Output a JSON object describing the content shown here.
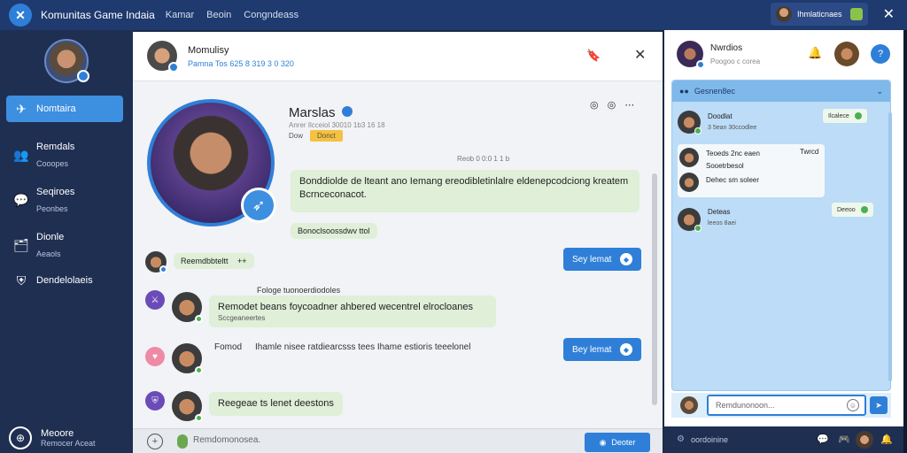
{
  "topbar": {
    "app_title": "Komunitas Game Indaia",
    "nav": [
      "Kamar",
      "Beoin",
      "Congndeass"
    ],
    "user_name": "Ihmlaticnaes",
    "close_glyph": "✕",
    "logo_glyph": "✕"
  },
  "sidebar": {
    "items": [
      {
        "icon": "run-icon",
        "glyph": "✈",
        "label": "Nomtaira",
        "sub": ""
      },
      {
        "icon": "users-icon",
        "glyph": "👥",
        "label": "Remdals",
        "sub": "Cooopes"
      },
      {
        "icon": "chat-icon",
        "glyph": "💬",
        "label": "Seqiroes",
        "sub": "Peonbes"
      },
      {
        "icon": "inbox-icon",
        "glyph": "🗂",
        "label": "Dionle",
        "sub": "Aeaols"
      },
      {
        "icon": "shield-icon",
        "glyph": "⛨",
        "label": "Dendelolaeis",
        "sub": ""
      }
    ],
    "bottom": {
      "label": "Meoore",
      "sub": "Remocer Aceat",
      "glyph": "⊕"
    }
  },
  "chat": {
    "header": {
      "name": "Momulisy",
      "sub": "Pamna Tos 625 8 319 3 0 320",
      "bookmark_glyph": "🔖",
      "close_glyph": "✕"
    },
    "profile": {
      "name": "Marslas",
      "meta": "Anrer Ilcceiol 30010 1b3 16 18",
      "level": "Dow",
      "tag": "Donct",
      "actions": [
        "◎",
        "◎",
        "⋯"
      ]
    },
    "timestamp": "Reob 0 0:0  1 1 b",
    "bubble_main": "Bonddiolde de lteant ano Iemang ereodibletinlalre eldenepcodciong kreatem Bcrnceconacot.",
    "reaction_line": "Bonoclsoossdwv ttol",
    "messages": [
      {
        "text": "Reemdbbteltt",
        "extra": "++"
      },
      {
        "label": "Fologe tuonoerdiodoles",
        "text": "Remodet beans foycoadner ahbered wecentrel elrocloanes",
        "sub": "Sccgeaneertes"
      },
      {
        "label": "Fomod",
        "text": "Ihamle nisee ratdiearcsss tees Ihame estioris teeelonel"
      },
      {
        "text": "Reegeae ts lenet deestons"
      }
    ],
    "send_label": "Sey lemat",
    "send_label2": "Bey lemat",
    "footer": {
      "placeholder": "Remdomonosea.",
      "send": "Deoter",
      "plus_glyph": "+"
    }
  },
  "right": {
    "header": {
      "name": "Nwrdios",
      "sub": "Poogoo c corea",
      "help_glyph": "?",
      "bell_glyph": "🔔"
    },
    "panel": {
      "title": "Gesnen8ec",
      "items": [
        {
          "name": "Doodlat",
          "sub": "3 5ean 30ccodlee",
          "pill": "Ilcalece"
        },
        {
          "name": "Teoeds 2nc eaen",
          "badge": "Twrcd"
        },
        {
          "name": "Sooetrbesol",
          "sub": ""
        },
        {
          "name": "Dehec sm soleer",
          "sub": ""
        },
        {
          "name": "Deteas",
          "sub": "leeos 8aei",
          "pill": "Deeoo"
        }
      ],
      "input_placeholder": "Remdunonoon..."
    },
    "footer": {
      "text": "oordoinine"
    }
  }
}
